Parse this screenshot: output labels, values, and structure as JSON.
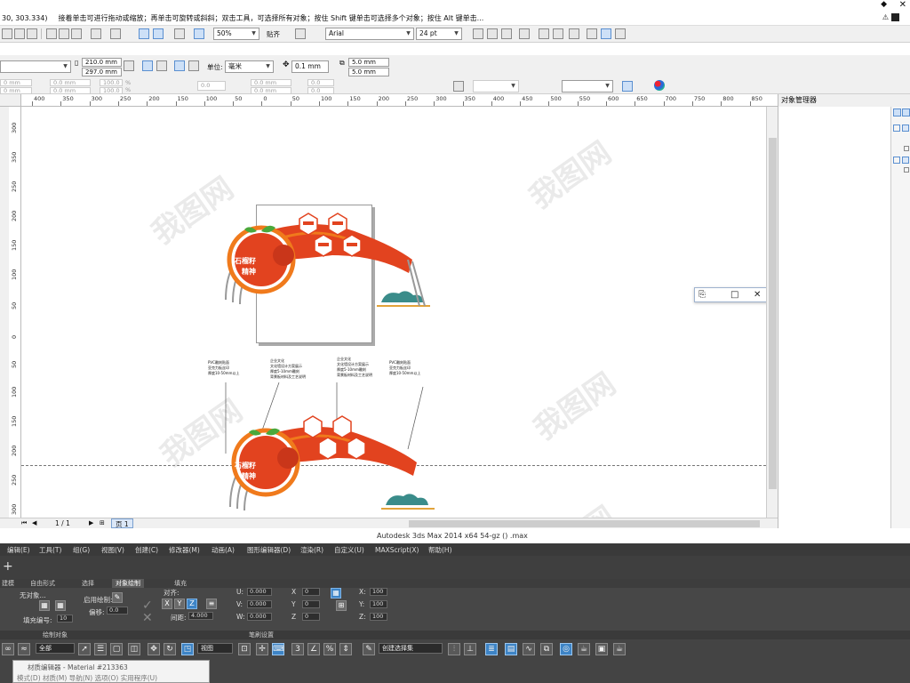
{
  "status": {
    "coords": "30, 303.334)",
    "hint": "接着单击可进行拖动或缩放；再单击可旋转或斜斜；双击工具，可选择所有对象；按住 Shift 键单击可选择多个对象；按住 Alt 键单击..."
  },
  "toolbar": {
    "zoom": "50%",
    "snap": "贴齐",
    "font": "Arial",
    "font_size": "24 pt"
  },
  "property_bar": {
    "width": "210.0 mm",
    "height": "297.0 mm",
    "unit_label": "单位:",
    "unit": "毫米",
    "nudge": "0.1 mm",
    "dup_x": "5.0 mm",
    "dup_y": "5.0 mm"
  },
  "transform_bar": {
    "x_pos": "0 mm",
    "y_pos": "0 mm",
    "w_val": "0.0 mm",
    "h_val": "0.0 mm",
    "scale_x": "100.0",
    "scale_y": "100.0",
    "pct": "%",
    "angle": "0.0",
    "skew_1": "0.0 mm",
    "skew_2": "0.0 mm",
    "angle_2": "0.0",
    "angle_3": "0.0"
  },
  "ruler": {
    "h_ticks": [
      "400",
      "350",
      "300",
      "250",
      "200",
      "150",
      "100",
      "50",
      "0",
      "50",
      "100",
      "150",
      "200",
      "250",
      "300",
      "350",
      "400",
      "450",
      "500",
      "550",
      "600",
      "650",
      "700",
      "750",
      "800",
      "850",
      "900"
    ],
    "v_ticks": [
      "300",
      "350",
      "250",
      "200",
      "150",
      "100",
      "50",
      "0",
      "50",
      "100",
      "150",
      "200",
      "250",
      "300"
    ],
    "unit_label": "毫米"
  },
  "right_panel": {
    "title": "对象管理器"
  },
  "page_nav": {
    "page_count": "1 / 1",
    "page_tab": "页 1"
  },
  "artwork": {
    "title_line1": "石榴籽",
    "title_line2": "精神",
    "title_line3": "石榴籽",
    "title_line4": "精神",
    "notes": [
      [
        "PVC雕刻贴面",
        "亚克力板丝印",
        "厚度10-50mm以上"
      ],
      [
        "企业文化",
        "文化墙设计方案展示",
        "厚度5-10mm雕刻",
        "背景板材料及工艺说明"
      ],
      [
        "企业文化",
        "文化墙设计方案展示",
        "厚度5-10mm雕刻",
        "背景板材料及工艺说明"
      ],
      [
        "PVC雕刻贴面",
        "亚克力板丝印",
        "厚度10-50mm以上"
      ]
    ]
  },
  "max": {
    "title": "Autodesk 3ds Max  2014 x64       54-gz  ()  .max",
    "menu": [
      "编辑(E)",
      "工具(T)",
      "组(G)",
      "视图(V)",
      "创建(C)",
      "修改器(M)",
      "动画(A)",
      "图形编辑器(D)",
      "渲染(R)",
      "自定义(U)",
      "MAXScript(X)",
      "帮助(H)"
    ],
    "ribbon_tabs": [
      "建模",
      "自由形式",
      "选择",
      "对象绘制",
      "填充"
    ],
    "ribbon": {
      "no_object": "无对象...",
      "fill_count_label": "填充编号:",
      "fill_count": "10",
      "enable_draw": "启用绘制:",
      "offset_label": "偏移:",
      "offset": "0.0",
      "align_label": "对齐:",
      "spacing_label": "间距:",
      "spacing": "4.000",
      "u": "U:",
      "v": "V:",
      "w": "W:",
      "u_val": "0.000",
      "v_val": "0.000",
      "w_val": "0.000",
      "x": "X",
      "y": "Y",
      "z": "Z",
      "xv": "0",
      "yv": "0",
      "zv": "0",
      "x2": "X:",
      "y2": "Y:",
      "z2": "Z:",
      "x2v": "100",
      "y2v": "100",
      "z2v": "100",
      "draw_objects": "绘制对象",
      "brush_settings": "笔刷设置"
    },
    "main_toolbar": {
      "filter": "全部",
      "view": "视图",
      "named_sel": "创建选择集"
    },
    "material_window": {
      "title": "材质编辑器 - Material #213363",
      "menu": "模式(D)  材质(M)  导航(N)  选项(O)  实用程序(U)"
    }
  },
  "watermark": "我图网",
  "colors": {
    "accent_red": "#e2431f",
    "accent_orange": "#f07a1c",
    "teal": "#3a8c8a",
    "panel_gray": "#f0f0f0",
    "max_dark": "#444444",
    "highlight_blue": "#3d84c6"
  }
}
